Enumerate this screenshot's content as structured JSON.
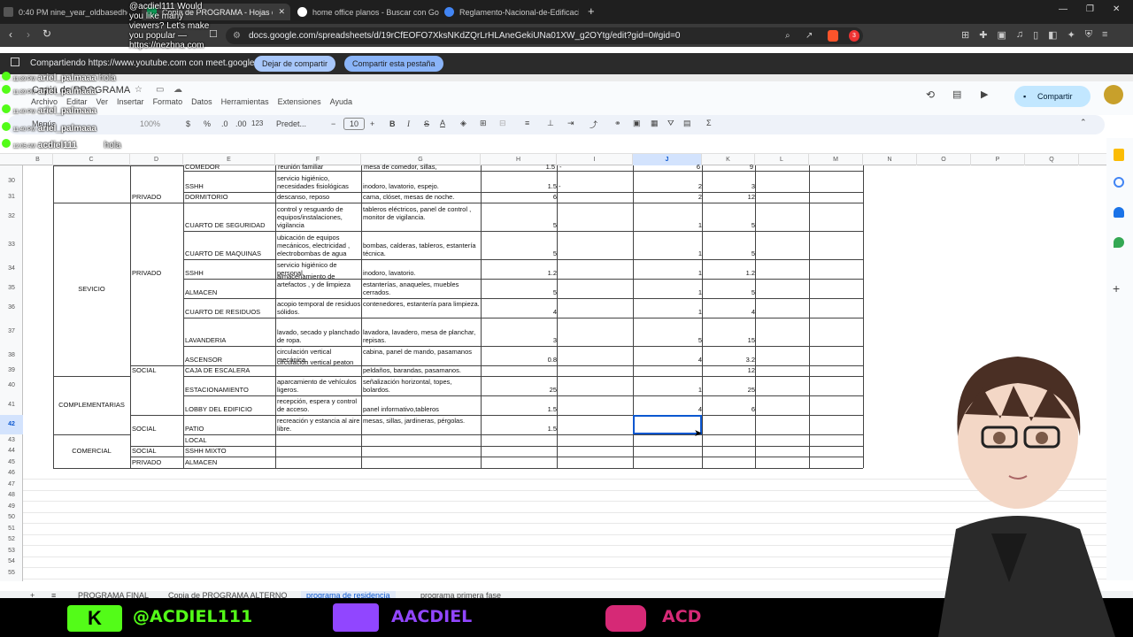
{
  "browser": {
    "tabs": [
      {
        "label": "0:40 PM  nine_year_oldbasedhedgehog",
        "active": false
      },
      {
        "label": "Copia de PROGRAMA - Hojas de",
        "active": true
      },
      {
        "label": "home office planos - Buscar con Go",
        "active": false
      },
      {
        "label": "Reglamento-Nacional-de-Edificacion",
        "active": false
      }
    ],
    "new_tab": "+",
    "url": "docs.google.com/spreadsheets/d/19rCfEOFO7XksNKdZQrLrHLAneGekiUNa01XW_g2OYtg/edit?gid=0#gid=0",
    "badge_count": "3"
  },
  "share_bar": {
    "text": "Compartiendo https://www.youtube.com con meet.google.com",
    "stop_button": "Dejar de compartir",
    "share_tab_button": "Compartir esta pestaña"
  },
  "doc": {
    "title": "Copia de PROGRAMA",
    "menus": [
      "Archivo",
      "Editar",
      "Ver",
      "Insertar",
      "Formato",
      "Datos",
      "Herramientas",
      "Extensiones",
      "Ayuda"
    ],
    "share_button": "Compartir",
    "toolbar": {
      "menus_label": "Menús",
      "zoom": "100%",
      "currency": "$",
      "percent": "%",
      "dec_less": ".0",
      "dec_more": ".00",
      "format_123": "123",
      "font": "Predet...",
      "font_size": "10",
      "bold": "B",
      "italic": "I",
      "strike": "S",
      "textcolor": "A"
    }
  },
  "columns": [
    "B",
    "C",
    "D",
    "E",
    "F",
    "G",
    "H",
    "I",
    "J",
    "K",
    "L",
    "M",
    "N",
    "O",
    "P",
    "Q"
  ],
  "selected_column": "J",
  "selected_row": "42",
  "row_numbers": [
    "30",
    "31",
    "32",
    "33",
    "34",
    "35",
    "36",
    "37",
    "38",
    "39",
    "40",
    "41",
    "42",
    "43",
    "44",
    "45",
    "46",
    "47",
    "48",
    "49",
    "50",
    "51",
    "52",
    "53",
    "54",
    "55"
  ],
  "sheet": {
    "top_partial": {
      "e": "COMEDOR",
      "f": "reunión familiar",
      "g": "mesa de comedor, sillas,",
      "h": "1.5",
      "i": "-",
      "j": "6",
      "k": "9"
    },
    "groups": {
      "servicio": "SEVICIO",
      "complementarias": "COMPLEMENTARIAS",
      "comercial": "COMERCIAL"
    },
    "rows": [
      {
        "r": "30",
        "d": "",
        "e": "SSHH",
        "f": "servicio higiénico, necesidades fisiológicas",
        "g": "inodoro, lavatorio, espejo.",
        "h": "1.5",
        "i": "-",
        "j": "2",
        "k": "3"
      },
      {
        "r": "31",
        "d": "PRIVADO",
        "e": "DORMITORIO",
        "f": "descanso, reposo",
        "g": "cama, clóset, mesas de noche.",
        "h": "6",
        "i": "",
        "j": "2",
        "k": "12"
      },
      {
        "r": "32",
        "d": "",
        "e": "CUARTO DE SEGURIDAD",
        "f": "control y resguardo de equipos/instalaciones, vigilancia",
        "g": "tableros eléctricos, panel de control , monitor de vigilancia.",
        "h": "5",
        "i": "",
        "j": "1",
        "k": "5"
      },
      {
        "r": "33",
        "d": "",
        "e": "CUARTO DE MAQUINAS",
        "f": "ubicación de equipos mecánicos, electricidad , electrobombas de agua",
        "g": "bombas, calderas, tableros, estantería técnica.",
        "h": "5",
        "i": "",
        "j": "1",
        "k": "5"
      },
      {
        "r": "34",
        "d": "PRIVADO",
        "e": "SSHH",
        "f": "servicio higiénico de personal.",
        "g": "inodoro, lavatorio.",
        "h": "1.2",
        "i": "",
        "j": "1",
        "k": "1.2"
      },
      {
        "r": "35",
        "d": "",
        "e": "ALMACEN",
        "f": "almacenamiento  de artefactos , y de limpieza",
        "g": "estanterías, anaqueles, muebles cerrados.",
        "h": "5",
        "i": "",
        "j": "1",
        "k": "5"
      },
      {
        "r": "36",
        "d": "",
        "e": "CUARTO DE RESIDUOS",
        "f": "acopio temporal de residuos sólidos.",
        "g": "contenedores, estantería para limpieza.",
        "h": "4",
        "i": "",
        "j": "1",
        "k": "4"
      },
      {
        "r": "37",
        "d": "",
        "e": "LAVANDERIA",
        "f": "lavado, secado y planchado de ropa.",
        "g": "lavadora, lavadero, mesa de planchar, repisas.",
        "h": "3",
        "i": "",
        "j": "5",
        "k": "15"
      },
      {
        "r": "38",
        "d": "",
        "e": "ASCENSOR",
        "f": "circulación vertical mecánica.",
        "g": "cabina, panel de mando, pasamanos",
        "h": "0.8",
        "i": "",
        "j": "4",
        "k": "3.2"
      },
      {
        "r": "39",
        "d": "SOCIAL",
        "e": "CAJA DE ESCALERA",
        "f": "circulación vertical peaton",
        "g": "peldaños, barandas, pasamanos.",
        "h": "",
        "i": "",
        "j": "",
        "k": "12"
      },
      {
        "r": "40",
        "d": "",
        "e": "ESTACIONAMIENTO",
        "f": "aparcamiento de vehículos ligeros.",
        "g": "señalización horizontal, topes, bolardos.",
        "h": "25",
        "i": "",
        "j": "1",
        "k": "25"
      },
      {
        "r": "41",
        "d": "",
        "e": "LOBBY DEL EDIFICIO",
        "f": "recepción, espera y control de acceso.",
        "g": "panel informativo,tableros",
        "h": "1.5",
        "i": "",
        "j": "4",
        "k": "6"
      },
      {
        "r": "42",
        "d": "SOCIAL",
        "e": "PATIO",
        "f": "recreación y estancia al aire libre.",
        "g": "mesas, sillas, jardineras, pérgolas.",
        "h": "1.5",
        "i": "",
        "j": "",
        "k": ""
      },
      {
        "r": "43",
        "d": "",
        "e": "LOCAL",
        "f": "",
        "g": "",
        "h": "",
        "i": "",
        "j": "",
        "k": ""
      },
      {
        "r": "44",
        "d": "SOCIAL",
        "e": "SSHH MIXTO",
        "f": "",
        "g": "",
        "h": "",
        "i": "",
        "j": "",
        "k": ""
      },
      {
        "r": "45",
        "d": "PRIVADO",
        "e": "ALMACEN",
        "f": "",
        "g": "",
        "h": "",
        "i": "",
        "j": "",
        "k": ""
      }
    ]
  },
  "sheet_tabs": [
    "PROGRAMA FINAL",
    "Copia de PROGRAMA ALTERNO",
    "programa de residencia",
    "programa primera fase"
  ],
  "active_sheet_tab": "programa de residencia",
  "chat": [
    {
      "user": "@acdiel111",
      "text": "Would you like many viewers? Let's make you popular — https://nezhna com"
    },
    {
      "time": "11:39 PM",
      "user": "ariel_palmaaa",
      "text": "hola"
    },
    {
      "time": "11:39 PM",
      "user": "ariel_palmaaa",
      "text": ""
    },
    {
      "time": "11:40 PM",
      "user": "ariel_palmaaa",
      "text": ""
    },
    {
      "time": "11:40 PM",
      "user": "ariel_palmaaa",
      "text": ""
    },
    {
      "time": "12:05 AM",
      "user": "acdiel111",
      "text": "hola"
    }
  ],
  "banner": {
    "kick": "@ACDIEL111",
    "twitch": "AACDIEL",
    "instagram": "ACD"
  },
  "colors": {
    "accent": "#0b57d0",
    "kick_green": "#53fc18",
    "twitch_purple": "#9146ff",
    "share_pill": "#8ab4f8"
  }
}
